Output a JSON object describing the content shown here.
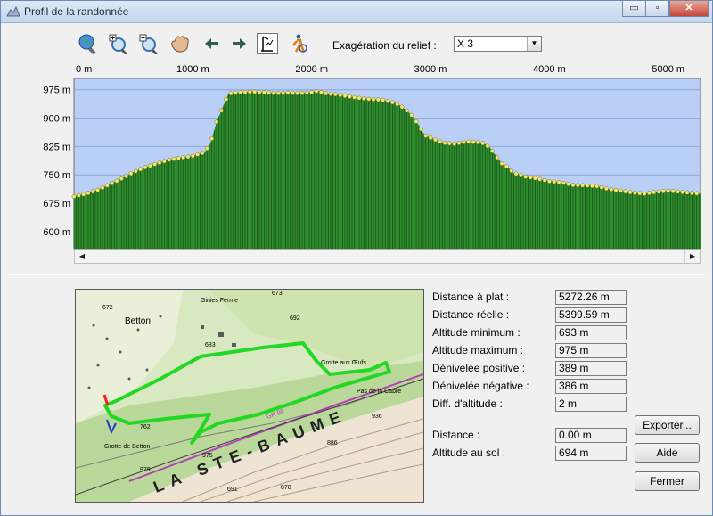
{
  "window": {
    "title": "Profil de la randonnée"
  },
  "titlebar_buttons": {
    "minimize": "▭",
    "maximize": "▫",
    "close": "✕"
  },
  "toolbar": {
    "tools": [
      "zoom-globe",
      "zoom-in",
      "zoom-out",
      "pan-hand",
      "back-arrow",
      "forward-arrow",
      "profile-select",
      "hiker-locate"
    ],
    "relief_label": "Exagération du relief :",
    "relief_value": "X 3"
  },
  "chart_data": {
    "type": "area",
    "x_unit": "m",
    "x_ticks": [
      "0 m",
      "1000 m",
      "2000 m",
      "3000 m",
      "4000 m",
      "5000 m"
    ],
    "x_tick_values": [
      0,
      1000,
      2000,
      3000,
      4000,
      5000
    ],
    "y_ticks": [
      "975 m",
      "900 m",
      "825 m",
      "750 m",
      "675 m",
      "600 m"
    ],
    "y_tick_values": [
      975,
      900,
      825,
      750,
      675,
      600
    ],
    "xlim": [
      0,
      5272
    ],
    "ylim": [
      555,
      1005
    ],
    "grid": true,
    "profile_x": [
      0,
      100,
      200,
      300,
      400,
      500,
      600,
      700,
      800,
      900,
      1000,
      1050,
      1100,
      1150,
      1200,
      1300,
      1400,
      1500,
      1600,
      1700,
      1800,
      1900,
      2000,
      2050,
      2100,
      2200,
      2300,
      2400,
      2500,
      2600,
      2700,
      2750,
      2800,
      2850,
      2900,
      2950,
      3000,
      3100,
      3200,
      3300,
      3400,
      3450,
      3500,
      3550,
      3600,
      3650,
      3700,
      3800,
      3900,
      4000,
      4100,
      4200,
      4300,
      4400,
      4500,
      4600,
      4700,
      4800,
      4900,
      5000,
      5100,
      5200,
      5272
    ],
    "profile_y": [
      693,
      700,
      710,
      725,
      740,
      757,
      770,
      780,
      790,
      795,
      800,
      805,
      810,
      835,
      890,
      965,
      968,
      970,
      968,
      966,
      967,
      966,
      968,
      972,
      966,
      963,
      958,
      953,
      950,
      948,
      940,
      932,
      920,
      905,
      882,
      855,
      848,
      835,
      832,
      838,
      836,
      833,
      822,
      800,
      780,
      770,
      755,
      745,
      740,
      733,
      730,
      723,
      722,
      720,
      712,
      708,
      703,
      700,
      705,
      708,
      705,
      702,
      700
    ]
  },
  "scrollbar": {
    "left": "◀",
    "right": "▶"
  },
  "map": {
    "labels": [
      "Betton",
      "Ginies Ferme",
      "Grotte aux Œufs",
      "Grotte de Betton",
      "Pas de la Cabre",
      "LA STE-BAUME",
      "GR 98",
      "672",
      "673",
      "683",
      "692",
      "762",
      "886",
      "936",
      "979",
      "975",
      "691",
      "878"
    ]
  },
  "stats": [
    {
      "label": "Distance à plat :",
      "value": "5272.26 m"
    },
    {
      "label": "Distance réelle :",
      "value": "5399.59 m"
    },
    {
      "label": "Altitude minimum :",
      "value": "693 m"
    },
    {
      "label": "Altitude maximum :",
      "value": "975 m"
    },
    {
      "label": "Dénivelée positive :",
      "value": "389 m"
    },
    {
      "label": "Dénivelée négative :",
      "value": "386 m"
    },
    {
      "label": "Diff. d'altitude :",
      "value": "2 m"
    }
  ],
  "cursor": [
    {
      "label": "Distance :",
      "value": "0.00 m"
    },
    {
      "label": "Altitude au sol :",
      "value": "694 m"
    }
  ],
  "buttons": {
    "export": "Exporter...",
    "help": "Aide",
    "close": "Fermer"
  }
}
